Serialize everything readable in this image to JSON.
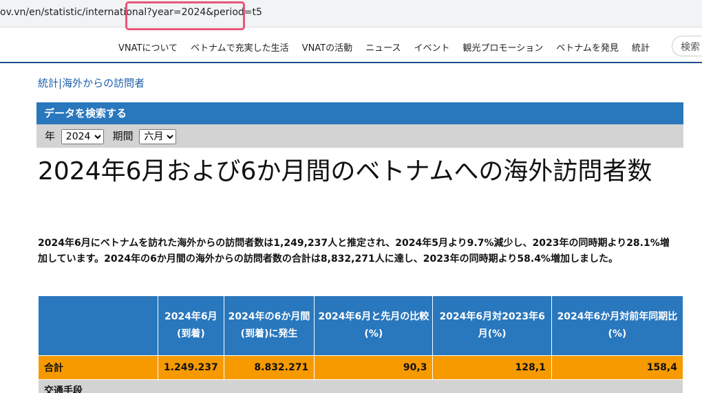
{
  "browser": {
    "url": "ov.vn/en/statistic/international?year=2024&period=t5"
  },
  "nav": {
    "items": [
      "VNATについて",
      "ベトナムで充実した生活",
      "VNATの活動",
      "ニュース",
      "イベント",
      "観光プロモーション",
      "ベトナムを発見",
      "統計"
    ],
    "search_label": "検索"
  },
  "breadcrumb": {
    "part1": "統計",
    "separator": "|",
    "part2": "海外からの訪問者"
  },
  "search_panel": {
    "header": "データを検索する",
    "year_label": "年",
    "year_value": "2024",
    "period_label": "期間",
    "period_value": "六月"
  },
  "page_title": "2024年6月および6か月間のベトナムへの海外訪問者数",
  "summary": "2024年6月にベトナムを訪れた海外からの訪問者数は1,249,237人と推定され、2024年5月より9.7%減少し、2023年の同時期より28.1%増加しています。2024年の6か月間の海外からの訪問者数の合計は8,832,271人に達し、2023年の同時期より58.4%増加しました。",
  "table": {
    "headers": [
      "",
      "2024年6月(到着)",
      "2024年の6か月間(到着)に発生",
      "2024年6月と先月の比較(%)",
      "2024年6月対2023年6月(%)",
      "2024年6か月対前年同期比(%)"
    ],
    "total_row": [
      "合計",
      "1.249.237",
      "8.832.271",
      "90,3",
      "128,1",
      "158,4"
    ],
    "section_label": "交通手段"
  },
  "colors": {
    "header_blue": "#2977bd",
    "total_orange": "#f79a00",
    "highlight_pink": "#e8557a",
    "link_blue": "#1a5ea8"
  }
}
